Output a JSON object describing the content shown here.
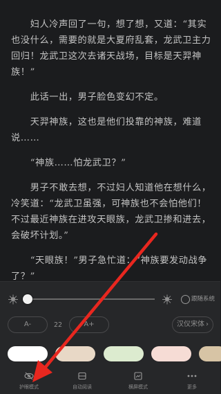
{
  "reader": {
    "paragraphs": [
      "妇人冷声回了一句，想了想，又道：“其实也没什么，需要的就是大夏府乱套，龙武卫主力回归！龙武卫这次去诸天战场，目标是天羿神族！”",
      "此话一出，男子脸色变幻不定。",
      "天羿神族，这也是他们投靠的神族，难道说……",
      "“神族……怕龙武卫？”",
      "男子不敢去想，不过妇人知道他在想什么，冷笑道：“龙武卫虽强，可神族也不会怕他们！不过最近神族在进攻天眼族，龙武卫掺和进去，会破坏计划。”",
      "“天眼族！”男子急忙道：“神族要发动战争了？”"
    ]
  },
  "settings": {
    "brightness": 0.0,
    "follow_system_label": "跟随系统",
    "font_decrease_label": "A-",
    "font_size": "22",
    "font_increase_label": "A+",
    "font_family_label": "汉仪宋体",
    "font_family_arrow": "›",
    "themes": [
      {
        "name": "white",
        "color": "#ffffff"
      },
      {
        "name": "beige",
        "color": "#e8d8c6"
      },
      {
        "name": "green",
        "color": "#dcebcf"
      },
      {
        "name": "pink",
        "color": "#f6dcd5"
      },
      {
        "name": "tan",
        "color": "#d7c4a5"
      }
    ]
  },
  "tabs": [
    {
      "label": "护眼模式",
      "icon": "eye-off-icon"
    },
    {
      "label": "自动阅读",
      "icon": "auto-read-icon"
    },
    {
      "label": "横屏模式",
      "icon": "landscape-icon"
    },
    {
      "label": "更多",
      "icon": "more-icon"
    }
  ],
  "annotation": {
    "arrow_color": "#e8271f"
  }
}
